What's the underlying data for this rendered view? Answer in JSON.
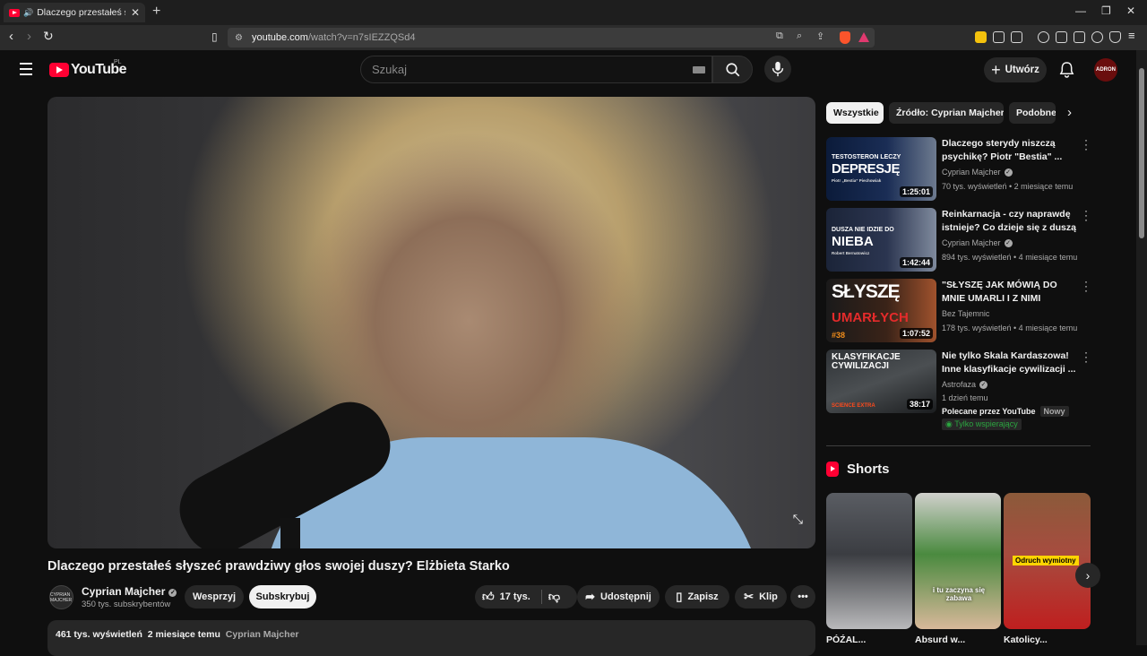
{
  "browser": {
    "tab_title": "Dlaczego przestałeś słyszeć p",
    "url_host": "youtube.com",
    "url_path": "/watch?v=n7sIEZZQSd4"
  },
  "masthead": {
    "logo_text": "YouTube",
    "country_code": "PL",
    "search_placeholder": "Szukaj",
    "create_label": "Utwórz",
    "avatar_text": "ADRON"
  },
  "video": {
    "title": "Dlaczego przestałeś słyszeć prawdziwy głos swojej duszy? Elżbieta Starko",
    "channel": "Cyprian Majcher",
    "channel_avatar_text": "CYPRIAN MAJCHER",
    "subscribers": "350 tys. subskrybentów",
    "support_label": "Wesprzyj",
    "subscribe_label": "Subskrybuj",
    "likes": "17 tys.",
    "share_label": "Udostępnij",
    "save_label": "Zapisz",
    "clip_label": "Klip",
    "views": "461 tys. wyświetleń",
    "age": "2 miesiące temu",
    "desc_channel": "Cyprian Majcher"
  },
  "chips": [
    {
      "label": "Wszystkie"
    },
    {
      "label": "Źródło: Cyprian Majcher"
    },
    {
      "label": "Podobne"
    }
  ],
  "recommendations": [
    {
      "title": "Dlaczego sterydy niszczą psychikę? Piotr \"Bestia\" ...",
      "channel": "Cyprian Majcher",
      "meta": "70 tys. wyświetleń • 2 miesiące temu",
      "duration": "1:25:01",
      "thumb_line1": "TESTOSTERON LECZY",
      "thumb_line2": "DEPRESJĘ",
      "thumb_line3": "Piotr „Bestia” Piechowiak"
    },
    {
      "title": "Reinkarnacja - czy naprawdę istnieje? Co dzieje się z duszą ...",
      "channel": "Cyprian Majcher",
      "meta": "894 tys. wyświetleń • 4 miesiące temu",
      "duration": "1:42:44",
      "thumb_line1": "DUSZA NIE IDZIE DO",
      "thumb_line2": "NIEBA",
      "thumb_line3": "Robert Bernatowicz"
    },
    {
      "title": "\"SŁYSZĘ JAK MÓWIĄ DO MNIE UMARLI I Z NIMI ROZMAWIA...",
      "channel": "Bez Tajemnic",
      "meta": "178 tys. wyświetleń • 4 miesiące temu",
      "duration": "1:07:52",
      "thumb_line1": "SŁYSZĘ",
      "thumb_line2": "UMARŁYCH",
      "thumb_line3": "#38"
    },
    {
      "title": "Nie tylko Skala Kardaszowa! Inne klasyfikacje cywilizacji ...",
      "channel": "Astrofaza",
      "meta": "1 dzień temu",
      "duration": "38:17",
      "thumb_line1": "KLASYFIKACJE CYWILIZACJI",
      "thumb_line2": "SCIENCE EXTRA",
      "promoted": "Polecane przez YouTube",
      "new_tag": "Nowy",
      "members_tag": "Tylko wspierający"
    }
  ],
  "shorts": {
    "heading": "Shorts",
    "items": [
      {
        "title": "PÓŹAL...",
        "caption": ""
      },
      {
        "title": "Absurd w...",
        "caption": "i tu zaczyna się zabawa"
      },
      {
        "title": "Katolicy...",
        "caption": "Odruch wymiotny"
      }
    ]
  }
}
